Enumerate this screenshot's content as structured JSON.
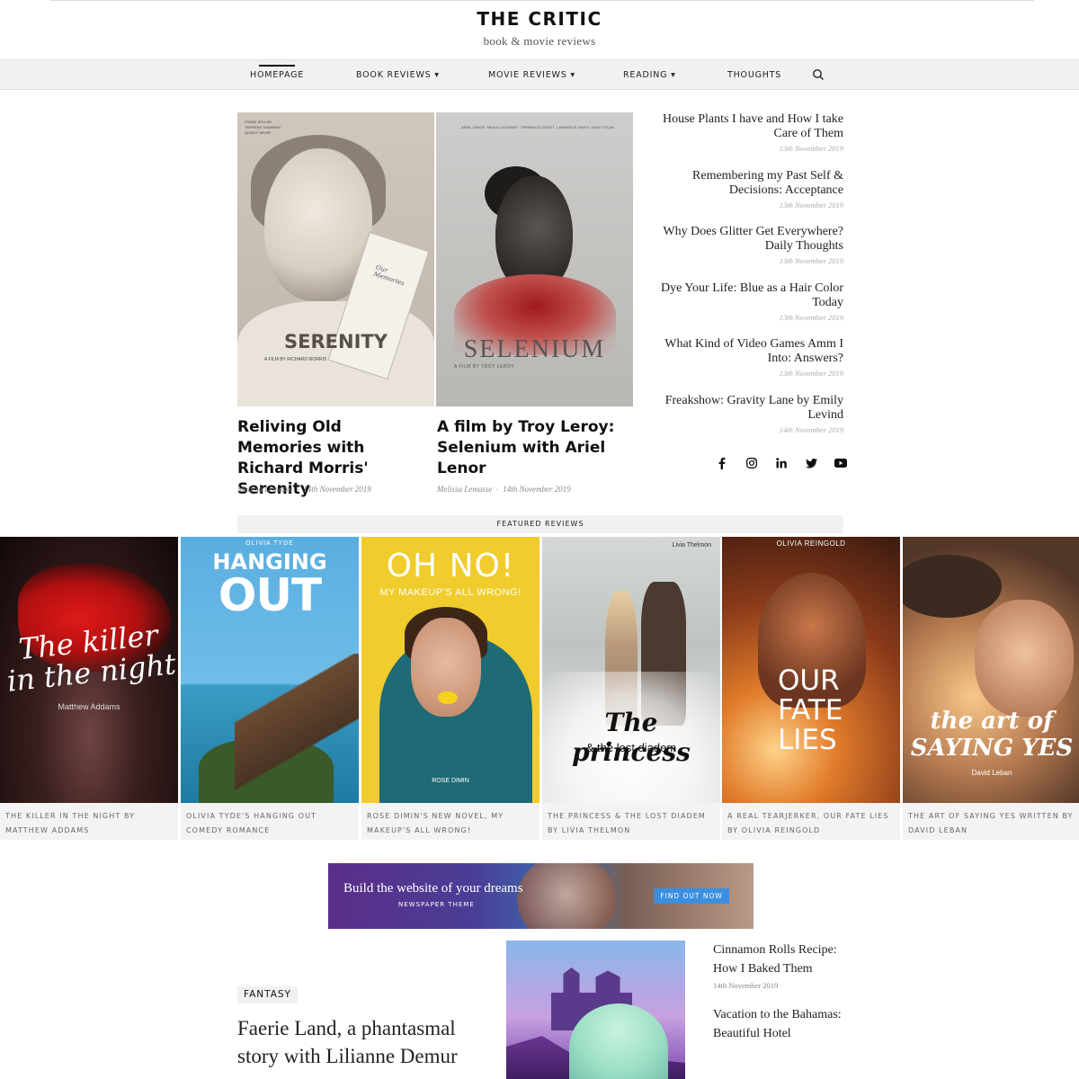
{
  "site": {
    "title": "THE CRITIC",
    "tagline": "book & movie reviews"
  },
  "nav": {
    "items": [
      {
        "label": "HOMEPAGE",
        "active": true
      },
      {
        "label": "BOOK REVIEWS ▾"
      },
      {
        "label": "MOVIE REVIEWS ▾"
      },
      {
        "label": "READING ▾"
      },
      {
        "label": "THOUGHTS"
      }
    ],
    "search_icon": "search-icon"
  },
  "hero": {
    "posters": [
      {
        "title": "SERENITY",
        "byline": "A FILM BY RICHARD MORRIS",
        "book_text": "Our Memories",
        "credits": [
          "FRANK SELLER",
          "TERRENE SHANNEN",
          "QUINCY MIYER"
        ]
      },
      {
        "title": "SELENIUM",
        "byline": "A FILM BY TROY LEROY",
        "credits": [
          "ARIEL LENOR",
          "MEIVA LOCKHART",
          "TERRENCE DOSITT",
          "LAWRENCE SMITH",
          "DAVE TITLAN"
        ]
      }
    ],
    "posts": [
      {
        "title": "Reliving Old Memories with Richard Morris' Serenity",
        "author": "Melissa Lemasse",
        "date": "14th November 2019"
      },
      {
        "title": "A film by Troy Leroy: Selenium with Ariel Lenor",
        "author": "Melissa Lemasse",
        "date": "14th November 2019"
      }
    ]
  },
  "sidebar_posts": [
    {
      "title": "House Plants I have and How I take Care of Them",
      "date": "13th November 2019"
    },
    {
      "title": "Remembering my Past Self & Decisions: Acceptance",
      "date": "13th November 2019"
    },
    {
      "title": "Why Does Glitter Get Everywhere? Daily Thoughts",
      "date": "13th November 2019"
    },
    {
      "title": "Dye Your Life: Blue as a Hair Color Today",
      "date": "13th November 2019"
    },
    {
      "title": "What Kind of Video Games Amm I Into: Answers?",
      "date": "13th November 2019"
    },
    {
      "title": "Freakshow: Gravity Lane by Emily Levind",
      "date": "14th November 2019"
    }
  ],
  "socials": [
    "facebook-icon",
    "instagram-icon",
    "linkedin-icon",
    "twitter-icon",
    "youtube-icon"
  ],
  "featured": {
    "heading": "FEATURED REVIEWS",
    "cards": [
      {
        "cover_title": "The killer in the night",
        "cover_author": "Matthew Addams",
        "caption": "THE KILLER IN THE NIGHT BY MATTHEW ADDAMS"
      },
      {
        "cover_author": "OLIVIA TYDE",
        "cover_title_1": "HANGING",
        "cover_title_2": "OUT",
        "caption": "OLIVIA TYDE'S HANGING OUT COMEDY ROMANCE"
      },
      {
        "cover_title": "OH NO!",
        "cover_subtitle": "MY MAKEUP'S ALL WRONG!",
        "cover_author": "ROSE DIMIN",
        "caption": "ROSE DIMIN'S NEW NOVEL, MY MAKEUP'S ALL WRONG!"
      },
      {
        "cover_author": "Livia Thelmon",
        "cover_title": "The princess",
        "cover_subtitle": "& the lost diadem",
        "caption": "THE PRINCESS & THE LOST DIADEM BY LIVIA THELMON"
      },
      {
        "cover_author": "OLIVIA REINGOLD",
        "cover_title": "OUR FATE LIES",
        "caption": "A REAL TEARJERKER, OUR FATE LIES BY OLIVIA REINGOLD"
      },
      {
        "cover_title": "the art of SAYING YES",
        "cover_author": "David Leban",
        "caption": "THE ART OF SAYING YES WRITTEN BY DAVID LEBAN"
      }
    ]
  },
  "ad": {
    "line1": "Build the website of your dreams",
    "line2": "NEWSPAPER THEME",
    "button": "FIND OUT NOW"
  },
  "bottom": {
    "category": "FANTASY",
    "title": "Faerie Land, a phantasmal story with Lilianne Demur",
    "side_posts": [
      {
        "title": "Cinnamon Rolls Recipe: How I Baked Them",
        "date": "14th November 2019"
      },
      {
        "title": "Vacation to the Bahamas: Beautiful Hotel"
      }
    ]
  }
}
